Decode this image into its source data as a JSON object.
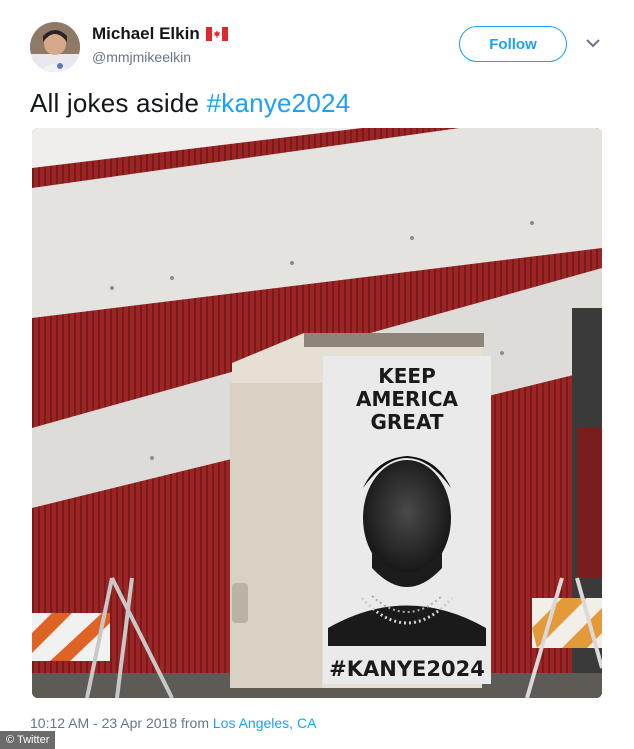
{
  "tweet": {
    "author_name": "Michael Elkin",
    "author_flag": "🇨🇦",
    "author_handle": "@mmjmikeelkin",
    "follow_label": "Follow",
    "text_plain": "All jokes aside",
    "text_hashtag": "#kanye2024",
    "timestamp": "10:12 AM - 23 Apr 2018 from",
    "location": "Los Angeles, CA"
  },
  "photo": {
    "poster_lines": [
      "KEEP",
      "AMERICA",
      "GREAT"
    ],
    "poster_hashtag": "#KANYE2024"
  },
  "credit": "© Twitter",
  "icons": {
    "menu": "chevron-down-icon",
    "flag": "canada-flag-icon"
  },
  "colors": {
    "accent": "#1da1f2",
    "secondary_text": "#657786"
  }
}
